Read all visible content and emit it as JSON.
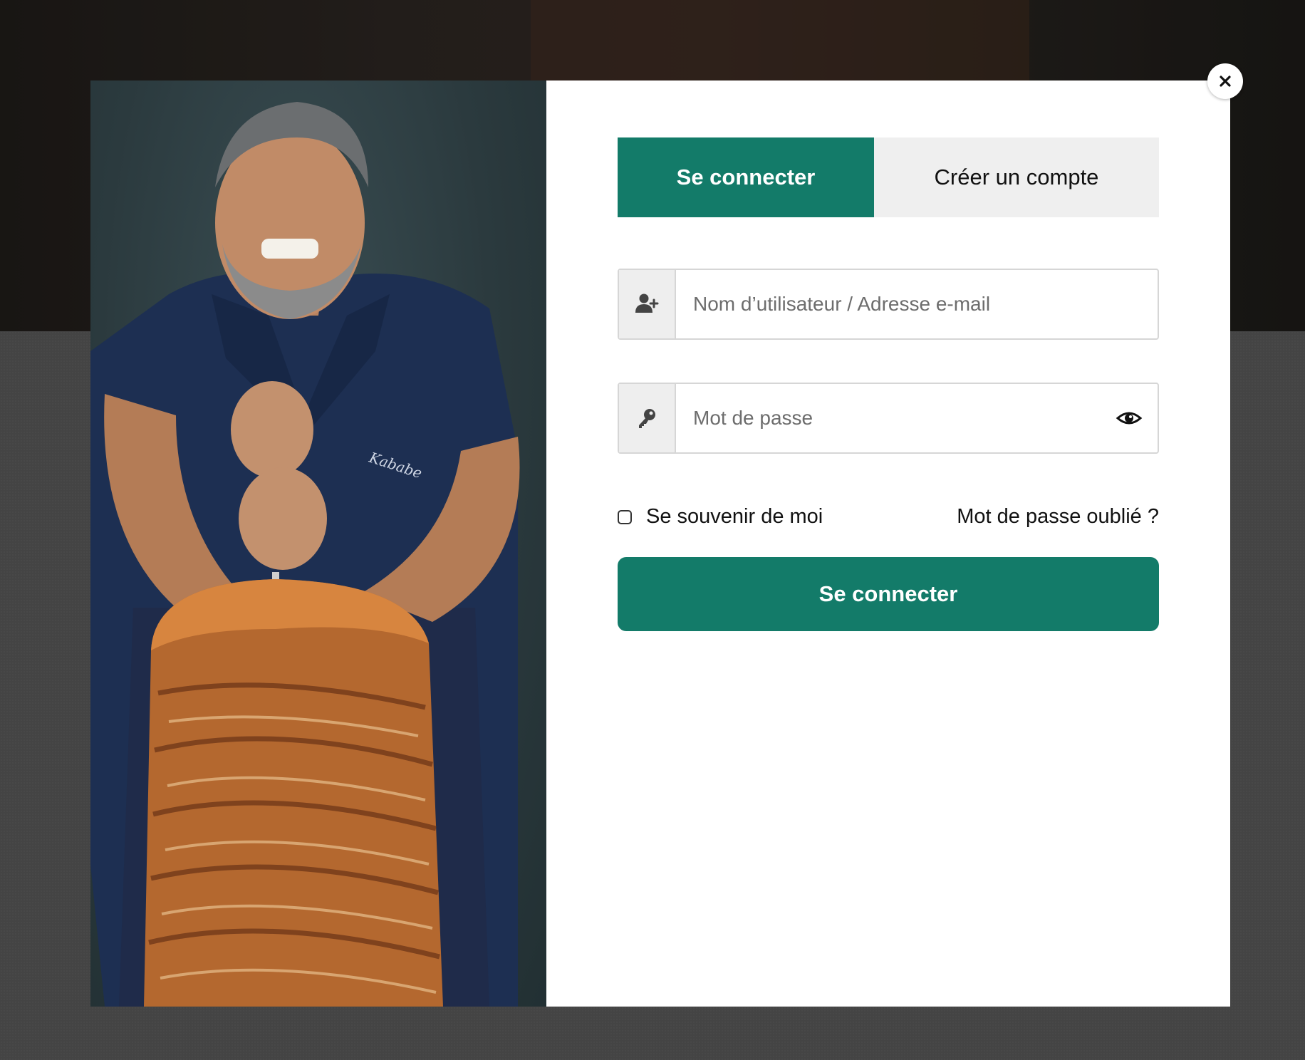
{
  "background": {
    "overlay": "dimmed-page"
  },
  "modal": {
    "close_icon": "close-icon",
    "photo": {
      "alt_role": "promo-photo",
      "shirt_lettering": "Kababe"
    },
    "tabs": [
      {
        "label": "Se connecter",
        "active": true
      },
      {
        "label": "Créer un compte",
        "active": false
      }
    ],
    "login": {
      "username": {
        "icon": "user-plus-icon",
        "placeholder": "Nom d’utilisateur / Adresse e-mail",
        "value": ""
      },
      "password": {
        "icon": "key-icon",
        "placeholder": "Mot de passe",
        "value": "",
        "toggle_icon": "eye-icon"
      },
      "remember_label": "Se souvenir de moi",
      "remember_checked": false,
      "forgot_label": "Mot de passe oublié ?",
      "submit_label": "Se connecter"
    }
  },
  "colors": {
    "accent": "#137b69",
    "tab_inactive_bg": "#efefef",
    "addon_bg": "#eeeeee"
  }
}
